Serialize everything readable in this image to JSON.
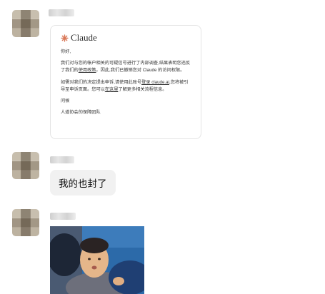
{
  "email": {
    "brand": "Claude",
    "greeting": "你好,",
    "p1_a": "我们对与您的帐户相关的可疑信号进行了内部调查,结果表明您违反了我们的",
    "p1_link": "使用政策",
    "p1_b": "。因此,我们已撤销您对 Claude 的访问权限。",
    "p2_a": "如需对我们的决定提出申诉,请使用此账号",
    "p2_link1": "登录 claude.ai",
    "p2_b": ",您将被引导至申诉页面。您可以",
    "p2_link2": "在这里",
    "p2_c": "了解更多相关流程信息。",
    "closing": "问候",
    "signature": "人道协会的保障团队"
  },
  "reply": {
    "text": "我的也封了"
  },
  "colors": {
    "brand_accent": "#d97757",
    "bubble_bg": "#f1f1f1"
  }
}
